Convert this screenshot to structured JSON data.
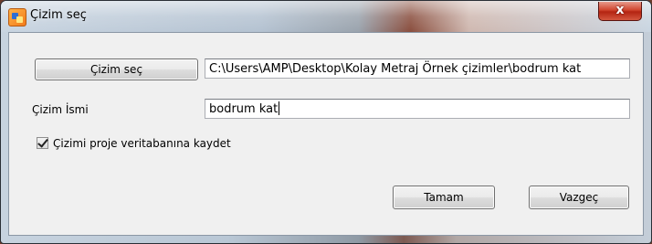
{
  "window": {
    "title": "Çizim seç",
    "close_glyph": "x"
  },
  "form": {
    "select_button_label": "Çizim seç",
    "path_value": "C:\\Users\\AMP\\Desktop\\Kolay Metraj Örnek çizimler\\bodrum kat",
    "name_label": "Çizim İsmi",
    "name_value": "bodrum kat",
    "save_checkbox_label": "Çizimi proje veritabanına kaydet",
    "save_checkbox_checked": true
  },
  "actions": {
    "ok_label": "Tamam",
    "cancel_label": "Vazgeç"
  },
  "icons": {
    "app": "app-icon",
    "close": "close-icon",
    "check": "check-icon"
  }
}
